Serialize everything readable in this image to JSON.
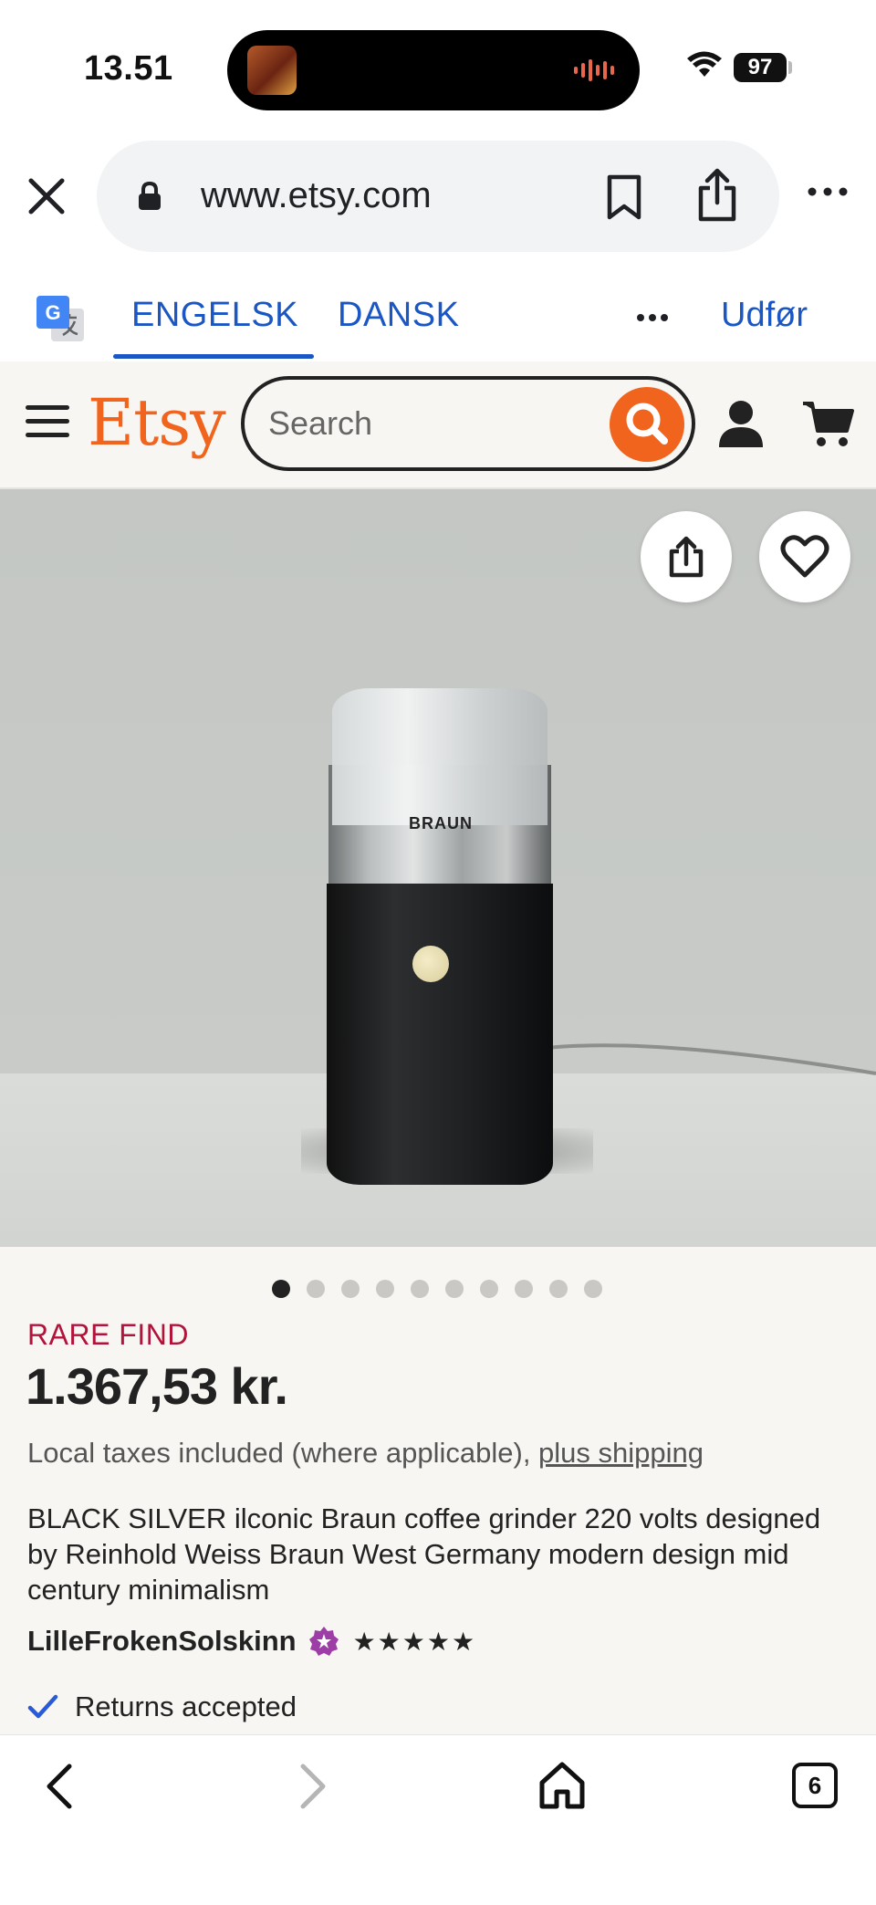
{
  "status_bar": {
    "time": "13.51",
    "battery": "97"
  },
  "browser": {
    "url": "www.etsy.com"
  },
  "translate_bar": {
    "tab_english": "ENGELSK",
    "tab_danish": "DANSK",
    "action": "Udfør"
  },
  "etsy_header": {
    "logo": "Etsy",
    "search_placeholder": "Search"
  },
  "product_image": {
    "brand_text": "BRAUN",
    "dot_count": 10,
    "active_dot": 0
  },
  "listing": {
    "badge": "RARE FIND",
    "price": "1.367,53 kr.",
    "tax_text": "Local taxes included (where applicable), ",
    "tax_link": "plus shipping",
    "title": "BLACK SILVER ilconic Braun coffee grinder 220 volts designed by Reinhold Weiss Braun West Germany modern design mid century minimalism",
    "seller_name": "LilleFrokenSolskinn",
    "stars": "★★★★★",
    "returns": "Returns accepted"
  },
  "bottom_nav": {
    "tab_count": "6"
  },
  "colors": {
    "etsy_orange": "#f1641e",
    "translate_blue": "#1a56c4",
    "rare_find_red": "#b3123a",
    "star_seller_purple": "#9d3ea6"
  }
}
